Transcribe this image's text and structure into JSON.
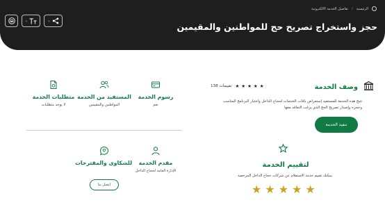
{
  "breadcrumb": {
    "home": "الرئيسية",
    "separator": "/",
    "current": "تفاصيل الخدمة الالكترونية"
  },
  "page_title": "حجز واستخراج تصريح حج للمواطنين والمقيمين",
  "toolbar": {
    "share_icon": "share-icon",
    "text_size_icon": "text-size-icon",
    "print_icon": "print-icon",
    "dropdown_caret": "⌄"
  },
  "description": {
    "title": "وصف الخدمة",
    "icon": "building-icon",
    "rating_count": "138 تقييمات",
    "rating_stars": [
      "★",
      "★",
      "★",
      "★",
      "★"
    ],
    "text": "تتيح هذه الخدمة للمستفيد إستعراض باقات الخدمات لحجاج الداخل واختيار البرنامج المناسب وحجزه وإصدار تصريح الحج الذي يرغب التعاقد معها",
    "execute_button": "تنفيذ الخدمة"
  },
  "evaluate": {
    "icon": "star-outline-icon",
    "title": "لتقييم الخدمة",
    "text": "يمكنك تقييم خدمة الاستعلام عن شركات حجاج الداخل المرخصة",
    "stars": [
      "★",
      "★",
      "★",
      "★",
      "★"
    ],
    "star_color": "#c9a227"
  },
  "cards": {
    "fees": {
      "icon": "card-icon",
      "title": "رسوم الخدمة",
      "value": "نعم"
    },
    "beneficiary": {
      "icon": "users-icon",
      "title": "المستفيد من الخدمة",
      "value": "المواطنين والمقيمين"
    },
    "requirements": {
      "icon": "document-icon",
      "title": "متطلبات الخدمة",
      "value": "لا يوجد متطلبات"
    },
    "provider": {
      "icon": "person-icon",
      "title": "مقدم الخدمة",
      "value": "الإدارة العامة لحجاج الداخل"
    },
    "complaints": {
      "icon": "feedback-icon",
      "title": "للشكاوى والمقترحات",
      "button": "اتصل بنا"
    }
  },
  "colors": {
    "accent": "#0f7a44",
    "header_bg": "#1e1e1e",
    "star": "#c9a227"
  }
}
